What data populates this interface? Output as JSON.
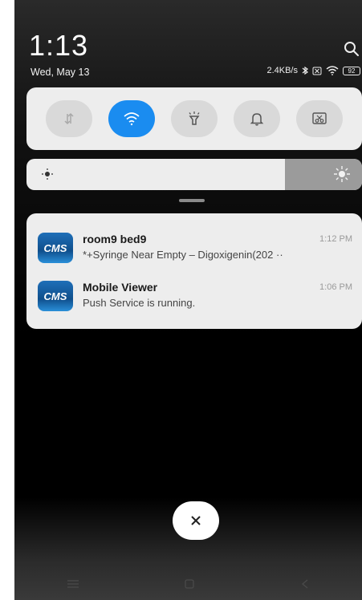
{
  "status": {
    "time": "1:13",
    "date": "Wed, May 13",
    "net_speed": "2.4KB/s",
    "battery": "92"
  },
  "quick_settings": {
    "tiles": [
      {
        "icon": "mobile-data-icon",
        "active": false
      },
      {
        "icon": "wifi-icon",
        "active": true
      },
      {
        "icon": "flashlight-icon",
        "active": false
      },
      {
        "icon": "bell-icon",
        "active": false
      },
      {
        "icon": "screenshot-icon",
        "active": false
      }
    ]
  },
  "brightness": {
    "level": 0.77
  },
  "notifications": [
    {
      "app_icon_label": "CMS",
      "title": "room9 bed9",
      "time": "1:12 PM",
      "body": "*+Syringe Near Empty – Digoxigenin(202 ··"
    },
    {
      "app_icon_label": "CMS",
      "title": "Mobile Viewer",
      "time": "1:06 PM",
      "body": "Push Service is running."
    }
  ],
  "colors": {
    "accent": "#1a8cf0",
    "card": "#ededed"
  }
}
